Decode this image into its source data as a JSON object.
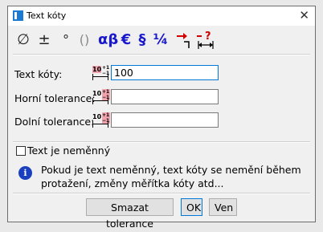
{
  "window": {
    "title": "Text kóty",
    "close_glyph": "✕"
  },
  "toolbar": [
    {
      "name": "diameter",
      "glyph": "∅"
    },
    {
      "name": "plus-minus",
      "glyph": "±"
    },
    {
      "name": "degree",
      "glyph": "°"
    },
    {
      "name": "parentheses",
      "glyph": "()"
    },
    {
      "name": "greek",
      "glyph": "αβ"
    },
    {
      "name": "euro",
      "glyph": "€"
    },
    {
      "name": "section",
      "glyph": "§"
    },
    {
      "name": "fraction",
      "glyph": "¼"
    }
  ],
  "form": {
    "text_label": "Text kóty:",
    "text_value": "100",
    "upper_label": "Horní tolerance:",
    "upper_value": "",
    "lower_label": "Dolní tolerance:",
    "lower_value": "",
    "icon_number": "10",
    "icon_tol": "+1 −1"
  },
  "fixed_checkbox": {
    "label": "Text je neměnný",
    "checked": false
  },
  "info": {
    "text": "Pokud je text neměnný, text kóty se nemění během protažení, změny měřítka kóty atd..."
  },
  "buttons": {
    "clear": "Smazat tolerance",
    "ok": "OK",
    "exit": "Ven"
  },
  "colors": {
    "accent": "#0078d7",
    "info_icon": "#1a3fbf",
    "toolbar_blue": "#1a1acc",
    "highlight": "#f0a3ad"
  }
}
